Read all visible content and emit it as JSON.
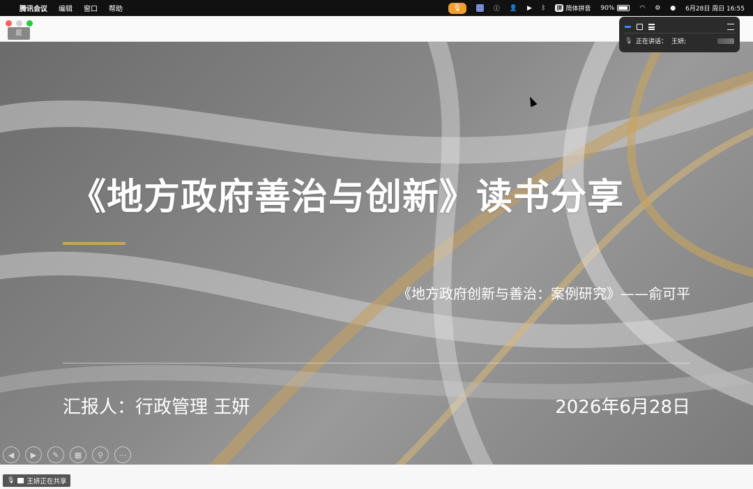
{
  "menubar": {
    "app_name": "腾讯会议",
    "menus": [
      "编辑",
      "窗口",
      "帮助"
    ],
    "ime": "拼",
    "ime_label": "简体拼音",
    "battery": "90%",
    "battery_level": 0.9,
    "clock": "6月28日 周日  16:55"
  },
  "window": {
    "thumb_label": "屁"
  },
  "slide": {
    "title": "《地方政府善治与创新》读书分享",
    "subtitle": "《地方政府创新与善治：案例研究》——俞可平",
    "reporter": "汇报人：行政管理 王妍",
    "date": "2026年6月28日",
    "accent": "#c8a45c"
  },
  "controls": [
    "prev",
    "next",
    "pen",
    "slides",
    "zoom",
    "more"
  ],
  "floating_panel": {
    "speaking_label": "正在讲话：",
    "speaker": "王妍;"
  },
  "share_badge": {
    "text": "王妍正在共享"
  }
}
